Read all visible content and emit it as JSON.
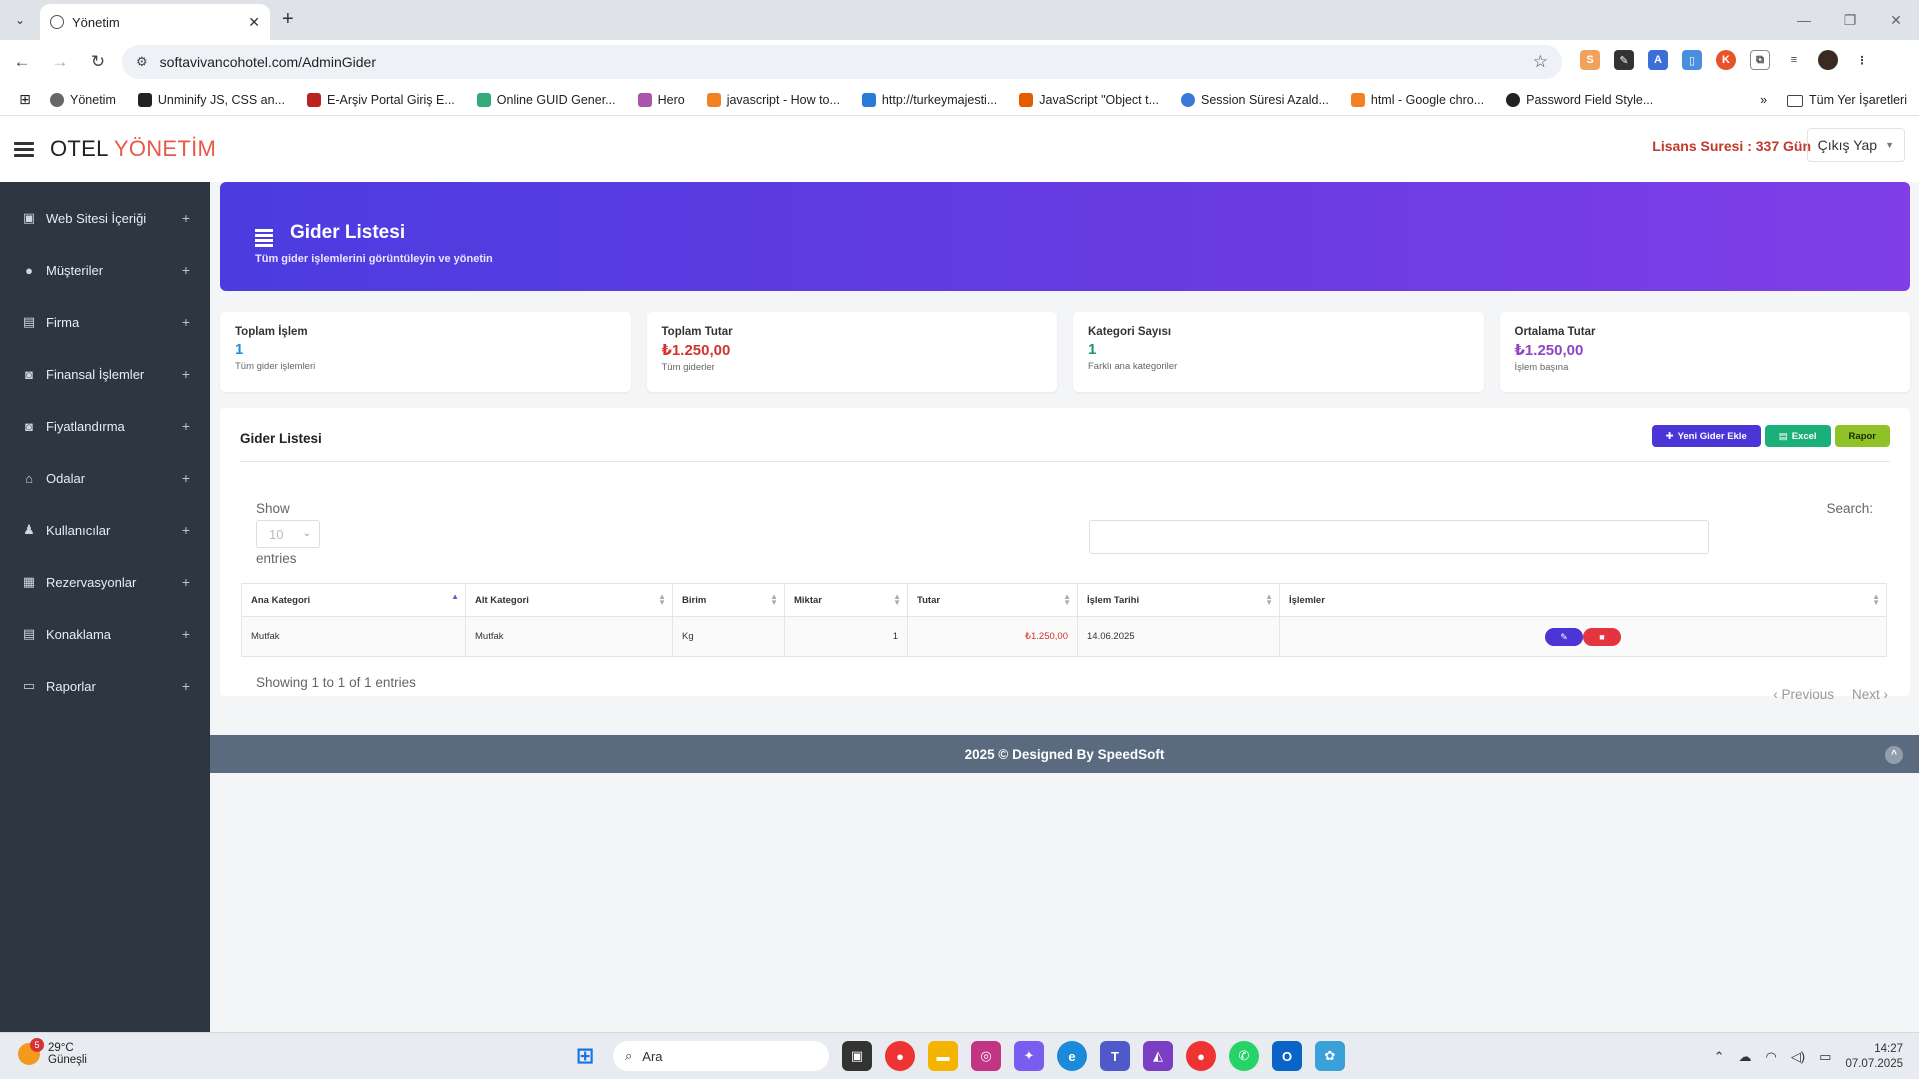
{
  "browser": {
    "tab_title": "Yönetim",
    "url": "softavivancohotel.com/AdminGider",
    "bookmarks": [
      "Yönetim",
      "Unminify JS, CSS an...",
      "E-Arşiv Portal Giriş E...",
      "Online GUID Gener...",
      "Hero",
      "javascript - How to...",
      "http://turkeymajesti...",
      "JavaScript \"Object t...",
      "Session Süresi Azald...",
      "html - Google chro...",
      "Password Field Style..."
    ],
    "all_bookmarks": "Tüm Yer İşaretleri",
    "more": "»"
  },
  "header": {
    "brand_main": "OTEL",
    "brand_accent": "YÖNETİM",
    "license": "Lisans Suresi : 337 Gün",
    "logout": "Çıkış Yap"
  },
  "sidebar": {
    "items": [
      {
        "label": "Web Sitesi İçeriği",
        "icon": "image-icon"
      },
      {
        "label": "Müşteriler",
        "icon": "user-icon"
      },
      {
        "label": "Firma",
        "icon": "building-icon"
      },
      {
        "label": "Finansal İşlemler",
        "icon": "money-icon"
      },
      {
        "label": "Fiyatlandırma",
        "icon": "money-icon"
      },
      {
        "label": "Odalar",
        "icon": "home-icon"
      },
      {
        "label": "Kullanıcılar",
        "icon": "person-icon"
      },
      {
        "label": "Rezervasyonlar",
        "icon": "calendar-icon"
      },
      {
        "label": "Konaklama",
        "icon": "building-icon"
      },
      {
        "label": "Raporlar",
        "icon": "folder-icon"
      }
    ]
  },
  "hero": {
    "title": "Gider Listesi",
    "subtitle": "Tüm gider işlemlerini görüntüleyin ve yönetin"
  },
  "stats": [
    {
      "title": "Toplam İşlem",
      "value": "1",
      "sub": "Tüm gider işlemleri",
      "color": "#1e90d6"
    },
    {
      "title": "Toplam Tutar",
      "value": "₺1.250,00",
      "sub": "Tüm giderler",
      "color": "#d0342c"
    },
    {
      "title": "Kategori Sayısı",
      "value": "1",
      "sub": "Farklı ana kategoriler",
      "color": "#1a9a5a"
    },
    {
      "title": "Ortalama Tutar",
      "value": "₺1.250,00",
      "sub": "İşlem başına",
      "color": "#8e44c4"
    }
  ],
  "card": {
    "title": "Gider Listesi",
    "btn_new": "Yeni Gider Ekle",
    "btn_excel": "Excel",
    "btn_report": "Rapor",
    "show": "Show",
    "page_size": "10",
    "entries": "entries",
    "search": "Search:",
    "columns": [
      "Ana Kategori",
      "Alt Kategori",
      "Birim",
      "Miktar",
      "Tutar",
      "İşlem Tarihi",
      "İşlemler"
    ],
    "rows": [
      {
        "ana": "Mutfak",
        "alt": "Mutfak",
        "birim": "Kg",
        "miktar": "1",
        "tutar": "₺1.250,00",
        "tarih": "14.06.2025"
      }
    ],
    "showing": "Showing 1 to 1 of 1 entries",
    "previous": "Previous",
    "next": "Next"
  },
  "footer": {
    "text": "2025 © Designed By SpeedSoft"
  },
  "taskbar": {
    "weather_temp": "29°C",
    "weather_desc": "Güneşli",
    "weather_badge": "5",
    "search": "Ara",
    "time": "14:27",
    "date": "07.07.2025"
  }
}
